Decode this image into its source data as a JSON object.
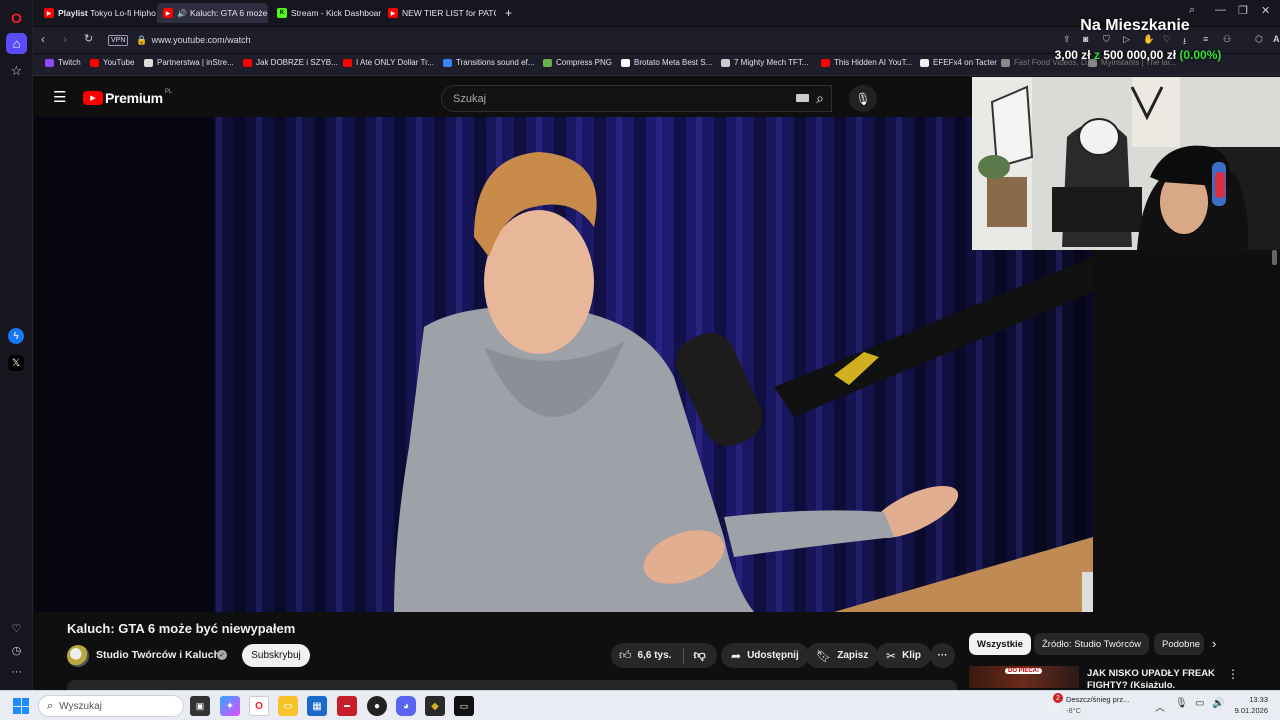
{
  "stream_overlay": {
    "title": "Na Mieszkanie",
    "donation_current": "3,00 zł",
    "donation_sep": "z",
    "donation_goal": "500 000,00 zł",
    "donation_percent": "(0.00%)",
    "colors": {
      "percent": "#30e030"
    }
  },
  "browser": {
    "tabs": [
      {
        "prefix": "Playlist",
        "label": "Tokyo Lo-fi Hiphop",
        "icon": "youtube-icon",
        "active": false
      },
      {
        "label": "Kaluch: GTA 6 może b",
        "icon": "speaker-icon",
        "active": true
      },
      {
        "label": "Stream - Kick Dashboard",
        "icon": "kick-icon",
        "active": false
      },
      {
        "label": "NEW TIER LIST for PATCH",
        "icon": "youtube-icon",
        "active": false
      }
    ],
    "new_tab_label": "+",
    "vpn_label": "VPN",
    "url": "www.youtube.com/watch",
    "ai_label": "Ai",
    "bookmarks": [
      {
        "label": "Twitch",
        "color": "#9146ff"
      },
      {
        "label": "YouTube",
        "color": "#ff0000"
      },
      {
        "label": "Partnerstwa | inStre...",
        "color": "#dddddd"
      },
      {
        "label": "Jak DOBRZE i SZYB...",
        "color": "#ff0000"
      },
      {
        "label": "I Ate ONLY Dollar Tr...",
        "color": "#ff0000"
      },
      {
        "label": "Transitions sound ef...",
        "color": "#3b82f6"
      },
      {
        "label": "Compress PNG",
        "color": "#6ab04c"
      },
      {
        "label": "Brotato Meta Best S...",
        "color": "#ffffff"
      },
      {
        "label": "7 Mighty Mech TFT...",
        "color": "#cccccc"
      },
      {
        "label": "This Hidden AI YouT...",
        "color": "#ff0000"
      },
      {
        "label": "EFEFx4 on Tacter",
        "color": "#eeeeee"
      },
      {
        "label": "Fast Food Videos, D...",
        "color": "#888888"
      },
      {
        "label": "Myinstants | The lar...",
        "color": "#888888"
      }
    ]
  },
  "youtube": {
    "logo_text": "Premium",
    "logo_region": "PL",
    "search_placeholder": "Szukaj",
    "video_title": "Kaluch: GTA 6 może być niewypałem",
    "channel_name": "Studio Twórców i Kaluch",
    "subscribe_label": "Subskrybuj",
    "like_count": "6,6 tys.",
    "share_label": "Udostępnij",
    "save_label": "Zapisz",
    "clip_label": "Klip",
    "more_label": "···",
    "chips": [
      "Wszystkie",
      "Źródło: Studio Twórców",
      "Podobne"
    ],
    "recommendation": {
      "title": "JAK NISKO UPADŁY FREAK FIGHTY? (Książulo, Żurnalista",
      "thumb_badge": "DO PIECA!"
    }
  },
  "taskbar": {
    "search_placeholder": "Wyszukaj",
    "weather_badge": "2",
    "weather_text": "Deszcz/śnieg prz...",
    "temperature": "-8°C",
    "time": "13:33",
    "date": "9.01.2026"
  }
}
